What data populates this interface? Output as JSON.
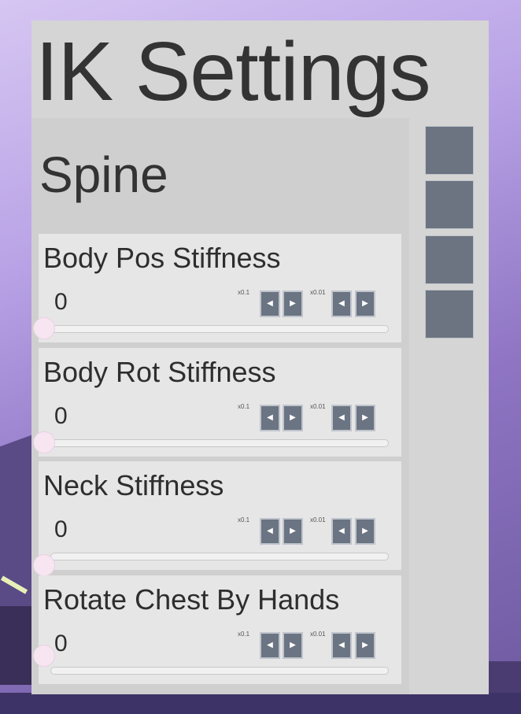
{
  "window": {
    "title": "IK Settings"
  },
  "section": {
    "title": "Spine"
  },
  "items": [
    {
      "label": "Body Pos Stiffness",
      "value": "0",
      "step_coarse": "x0.1",
      "step_fine": "x0.01",
      "slider_value": 0
    },
    {
      "label": "Body Rot Stiffness",
      "value": "0",
      "step_coarse": "x0.1",
      "step_fine": "x0.01",
      "slider_value": 0
    },
    {
      "label": "Neck Stiffness",
      "value": "0",
      "step_coarse": "x0.1",
      "step_fine": "x0.01",
      "slider_value": 0
    },
    {
      "label": "Rotate Chest By Hands",
      "value": "0",
      "step_coarse": "x0.1",
      "step_fine": "x0.01",
      "slider_value": 0
    }
  ],
  "icons": {
    "decrease": "◀",
    "increase": "▶"
  },
  "colors": {
    "panel": "#d5d5d5",
    "button": "#6a7482",
    "handle": "#f7e6f2",
    "text": "#333333"
  }
}
